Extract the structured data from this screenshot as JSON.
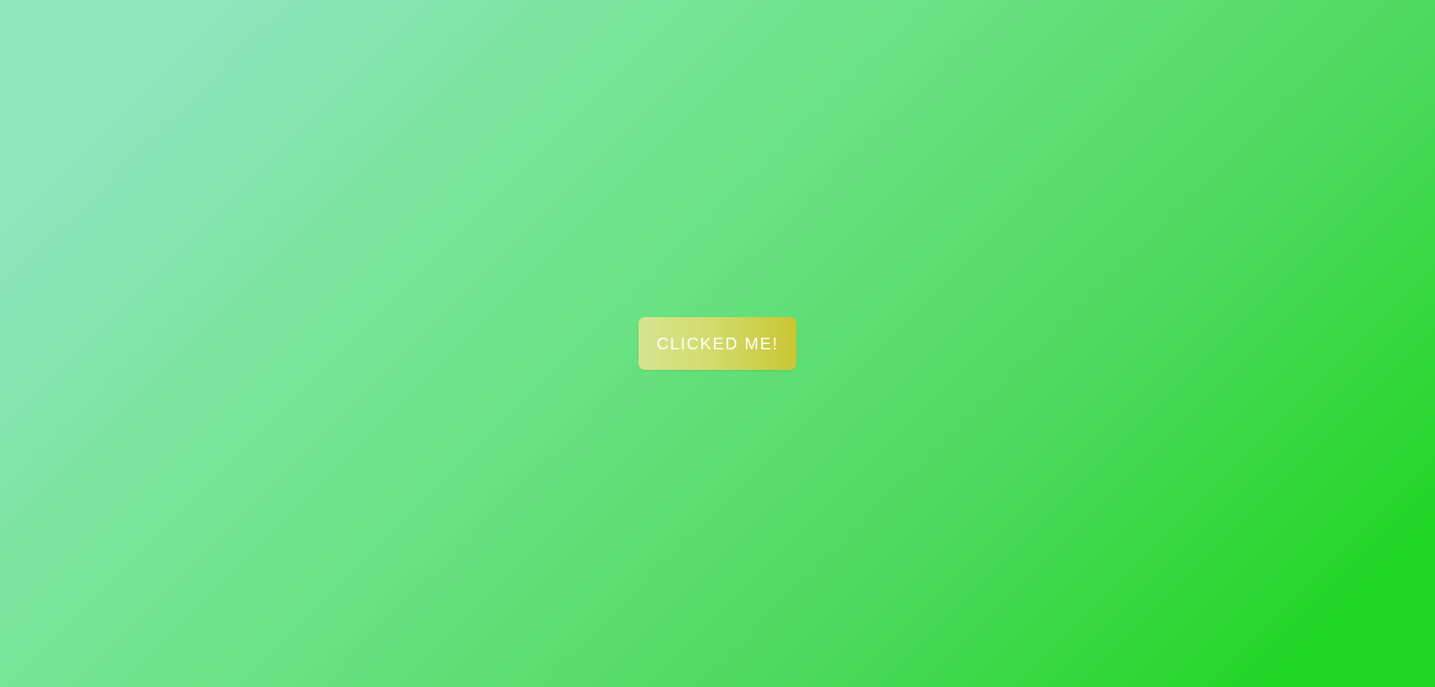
{
  "page": {
    "background_colors": [
      "#8ee6bf",
      "#6fe38a",
      "#4cd95c",
      "#22d626"
    ]
  },
  "main_button": {
    "label": "CLICKED ME!",
    "text_color": "#ffffff",
    "background_colors": [
      "#d6e48f",
      "#d2dc6d",
      "#cac533"
    ]
  }
}
